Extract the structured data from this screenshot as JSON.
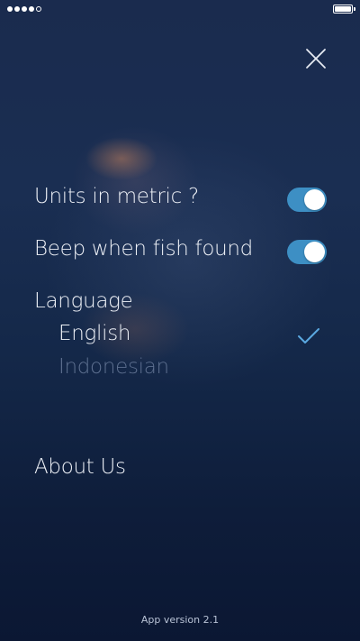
{
  "status_bar": {
    "signal_dots_filled": 4,
    "signal_dots_total": 5,
    "battery_level": 1.0
  },
  "icons": {
    "close": "close-icon",
    "check": "check-icon"
  },
  "settings": {
    "metric": {
      "label": "Units in metric ?",
      "enabled": true
    },
    "beep": {
      "label": "Beep when fish found",
      "enabled": true
    },
    "language": {
      "label": "Language",
      "options": [
        {
          "label": "English",
          "selected": true
        },
        {
          "label": "Indonesian",
          "selected": false
        }
      ]
    },
    "about_label": "About Us"
  },
  "footer": {
    "version": "App version 2.1"
  },
  "colors": {
    "background_top": "#1a2b4e",
    "background_bottom": "#0b1733",
    "toggle_on": "#3d8fc4",
    "text_primary": "#eef1f7",
    "text_muted": "#5d6f8f",
    "check": "#5aa8e0"
  }
}
